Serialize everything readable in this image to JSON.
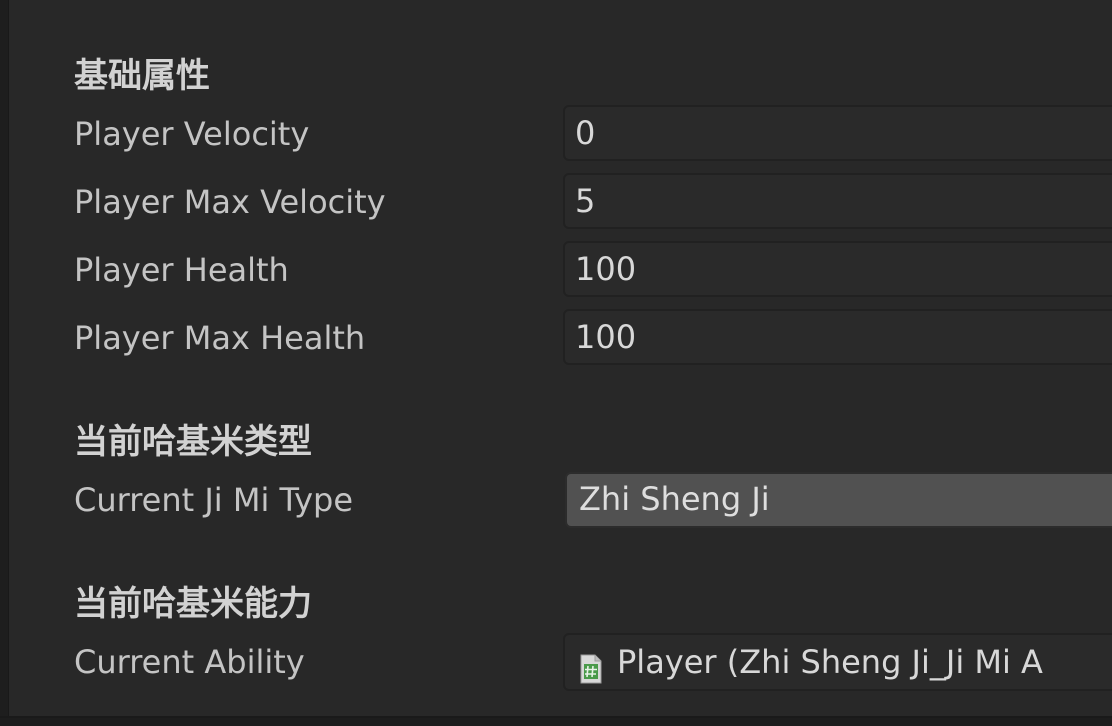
{
  "sections": {
    "basic": {
      "header": "基础属性",
      "fields": [
        {
          "label": "Player Velocity",
          "value": "0"
        },
        {
          "label": "Player Max Velocity",
          "value": "5"
        },
        {
          "label": "Player Health",
          "value": "100"
        },
        {
          "label": "Player Max Health",
          "value": "100"
        }
      ]
    },
    "type": {
      "header": "当前哈基米类型",
      "label": "Current Ji Mi Type",
      "value": "Zhi Sheng Ji"
    },
    "ability": {
      "header": "当前哈基米能力",
      "label": "Current Ability",
      "value": "Player (Zhi Sheng Ji_Ji Mi A",
      "icon": "script-icon"
    }
  },
  "colors": {
    "background": "#282828",
    "field_bg": "#2a2a2a",
    "dropdown_bg": "#515151",
    "label_text": "#c4c4c4",
    "header_text": "#d2d2d2",
    "script_icon_green": "#5cb85c"
  }
}
